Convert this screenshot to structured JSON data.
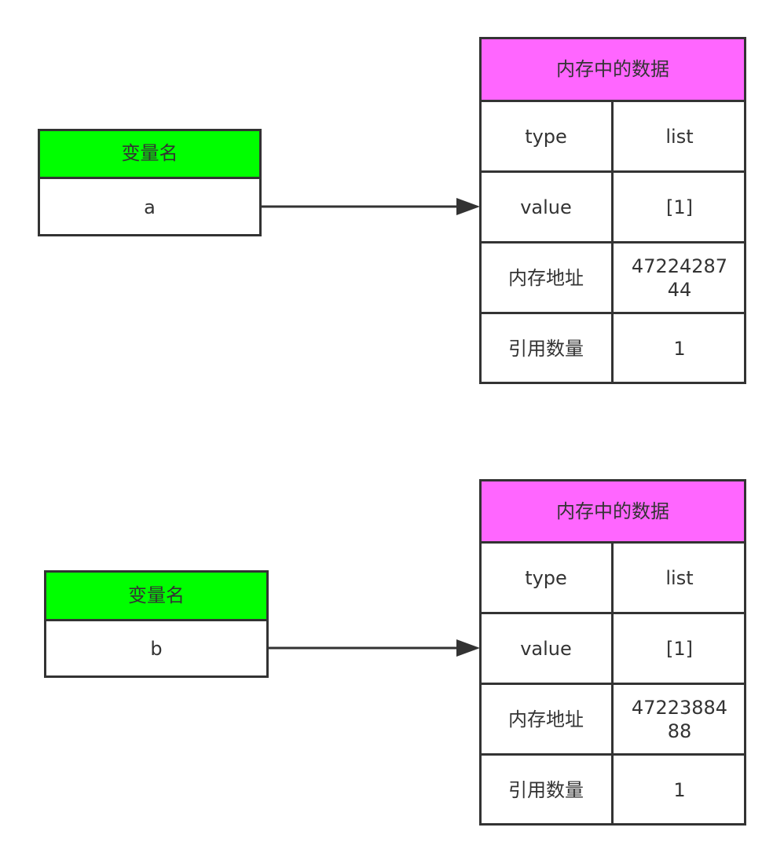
{
  "diagram": {
    "colors": {
      "variable_header": "#00ff00",
      "memory_header": "#ff66ff",
      "stroke": "#333333"
    },
    "groups": [
      {
        "variable": {
          "header": "变量名",
          "name": "a"
        },
        "memory": {
          "header": "内存中的数据",
          "rows": [
            {
              "label": "type",
              "value": "list"
            },
            {
              "label": "value",
              "value": "[1]"
            },
            {
              "label": "内存地址",
              "value": "4722428744"
            },
            {
              "label": "引用数量",
              "value": "1"
            }
          ]
        }
      },
      {
        "variable": {
          "header": "变量名",
          "name": "b"
        },
        "memory": {
          "header": "内存中的数据",
          "rows": [
            {
              "label": "type",
              "value": "list"
            },
            {
              "label": "value",
              "value": "[1]"
            },
            {
              "label": "内存地址",
              "value": "4722388488"
            },
            {
              "label": "引用数量",
              "value": "1"
            }
          ]
        }
      }
    ]
  }
}
